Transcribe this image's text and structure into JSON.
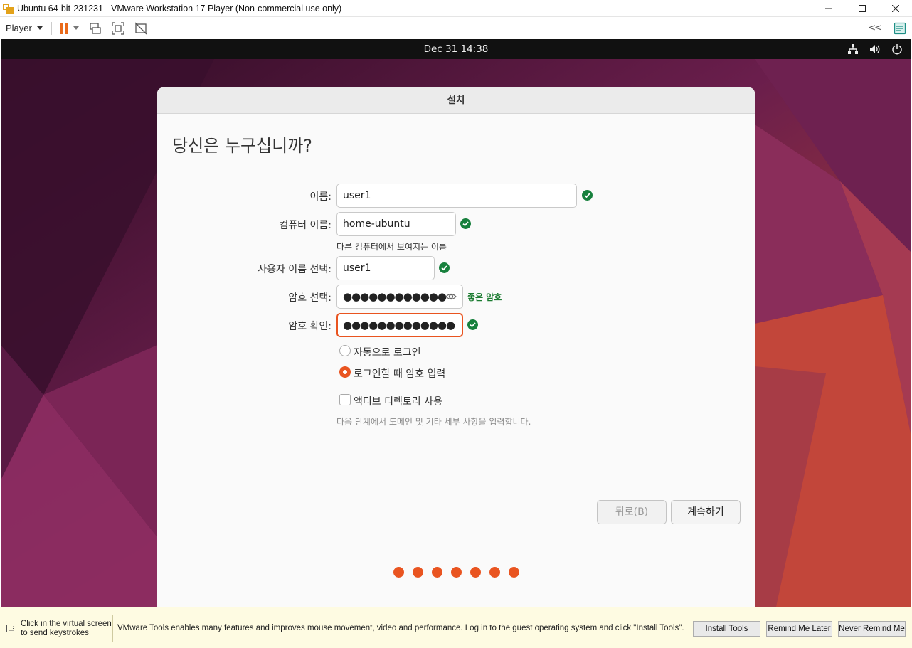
{
  "window": {
    "title": "Ubuntu 64-bit-231231 - VMware Workstation 17 Player (Non-commercial use only)",
    "minimize": "–",
    "maximize": "□",
    "close": "✕"
  },
  "toolbar": {
    "player_label": "Player",
    "collapse_label": "<<"
  },
  "guest_topbar": {
    "datetime": "Dec 31  14:38"
  },
  "installer": {
    "header": "설치",
    "title": "당신은 누구십니까?",
    "fields": {
      "name_label": "이름:",
      "name_value": "user1",
      "computer_label": "컴퓨터 이름:",
      "computer_value": "home-ubuntu",
      "computer_hint": "다른 컴퓨터에서 보여지는 이름",
      "username_label": "사용자 이름 선택:",
      "username_value": "user1",
      "password_label": "암호 선택:",
      "password_value": "●●●●●●●●●●●●",
      "password_strength": "좋은 암호",
      "confirm_label": "암호 확인:",
      "confirm_value": "●●●●●●●●●●●●●"
    },
    "options": {
      "auto_login": "자동으로 로그인",
      "require_password": "로그인할 때 암호 입력",
      "active_directory": "액티브 디렉토리 사용",
      "active_directory_hint": "다음 단계에서 도메인 및 기타 세부 사항을 입력합니다.",
      "selected": "require_password"
    },
    "buttons": {
      "back": "뒤로(B)",
      "continue": "계속하기"
    },
    "progress_steps": 7,
    "accent_color": "#e95420",
    "check_color": "#17803d"
  },
  "bottom_bar": {
    "hint_line1": "Click in the virtual screen",
    "hint_line2": "to send keystrokes",
    "message": "VMware Tools enables many features and improves mouse movement, video and performance. Log in to the guest operating system and click \"Install Tools\".",
    "install_tools": "Install Tools",
    "remind_later": "Remind Me Later",
    "never_remind": "Never Remind Me"
  }
}
